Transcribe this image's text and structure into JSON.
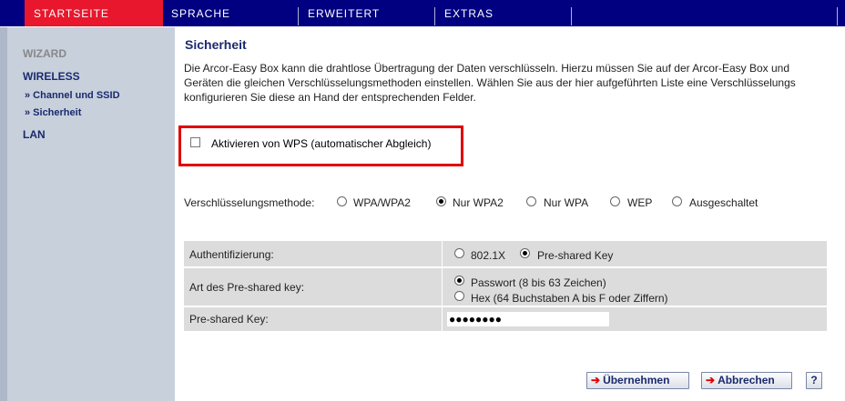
{
  "nav": {
    "tabs": [
      {
        "label": "STARTSEITE",
        "active": true
      },
      {
        "label": "SPRACHE",
        "active": false
      },
      {
        "label": "ERWEITERT",
        "active": false
      },
      {
        "label": "EXTRAS",
        "active": false
      }
    ]
  },
  "sidebar": {
    "wizard": "WIZARD",
    "wireless": "WIRELESS",
    "sub1": "» Channel und SSID",
    "sub2": "» Sicherheit",
    "lan": "LAN"
  },
  "main": {
    "title": "Sicherheit",
    "intro_lines": [
      "Die Arcor-Easy Box kann die drahtlose Übertragung der Daten verschlüsseln. Hierzu müssen Sie auf der Arcor-Easy Box und",
      "Geräten die gleichen Verschlüsselungsmethoden einstellen. Wählen Sie aus der hier aufgeführten Liste eine Verschlüsselungs",
      "konfigurieren Sie diese an Hand der entsprechenden Felder."
    ],
    "wps": {
      "label": "Aktivieren von WPS (automatischer Abgleich)",
      "checked": false
    },
    "encryption": {
      "label": "Verschlüsselungsmethode:",
      "options": [
        "WPA/WPA2",
        "Nur WPA2",
        "Nur WPA",
        "WEP",
        "Ausgeschaltet"
      ],
      "selected": "Nur WPA2"
    },
    "auth": {
      "label": "Authentifizierung:",
      "options": [
        "802.1X",
        "Pre-shared Key"
      ],
      "selected": "Pre-shared Key"
    },
    "psk_type": {
      "label": "Art des Pre-shared key:",
      "options": [
        "Passwort (8 bis 63 Zeichen)",
        "Hex (64 Buchstaben A bis F oder Ziffern)"
      ],
      "selected": "Passwort (8 bis 63 Zeichen)"
    },
    "psk": {
      "label": "Pre-shared Key:",
      "value": "●●●●●●●●"
    },
    "buttons": {
      "apply": "Übernehmen",
      "cancel": "Abbrechen",
      "help": "?"
    }
  },
  "colors": {
    "nav_bg": "#000080",
    "active_tab": "#e8172d",
    "sidebar_bg": "#c8d0dc",
    "highlight_border": "#e00000",
    "link": "#1a2a6e"
  }
}
